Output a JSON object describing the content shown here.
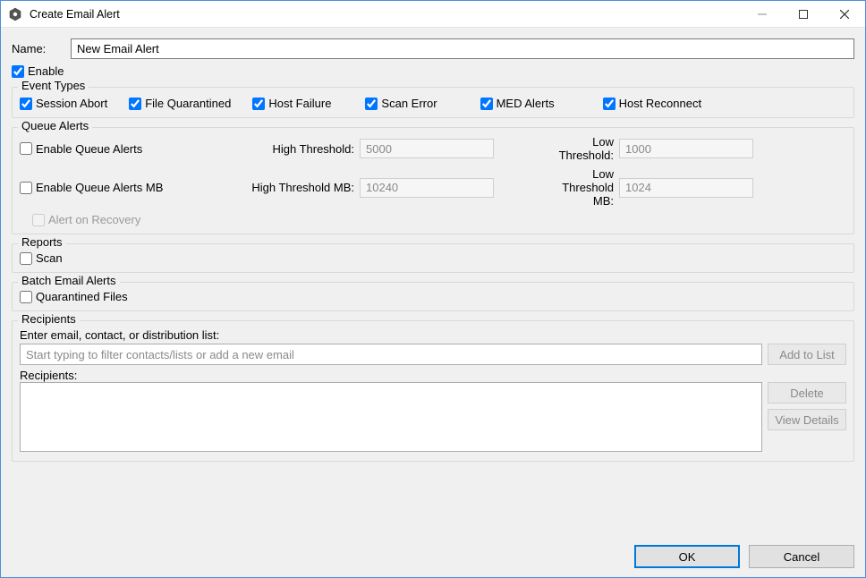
{
  "window": {
    "title": "Create Email Alert"
  },
  "name": {
    "label": "Name:",
    "value": "New Email Alert"
  },
  "enable": {
    "label": "Enable",
    "checked": true
  },
  "eventTypes": {
    "legend": "Event Types",
    "items": [
      {
        "label": "Session Abort",
        "checked": true
      },
      {
        "label": "File Quarantined",
        "checked": true
      },
      {
        "label": "Host Failure",
        "checked": true
      },
      {
        "label": "Scan Error",
        "checked": true
      },
      {
        "label": "MED Alerts",
        "checked": true
      },
      {
        "label": "Host Reconnect",
        "checked": true
      }
    ]
  },
  "queueAlerts": {
    "legend": "Queue Alerts",
    "enableQueueAlerts": {
      "label": "Enable Queue Alerts",
      "checked": false
    },
    "enableQueueAlertsMB": {
      "label": "Enable Queue Alerts MB",
      "checked": false
    },
    "alertOnRecovery": {
      "label": "Alert on Recovery",
      "checked": false,
      "disabled": true
    },
    "highThreshold": {
      "label": "High Threshold:",
      "value": "5000"
    },
    "lowThreshold": {
      "label": "Low Threshold:",
      "value": "1000"
    },
    "highThresholdMB": {
      "label": "High Threshold MB:",
      "value": "10240"
    },
    "lowThresholdMB": {
      "label": "Low Threshold MB:",
      "value": "1024"
    }
  },
  "reports": {
    "legend": "Reports",
    "scan": {
      "label": "Scan",
      "checked": false
    }
  },
  "batchEmailAlerts": {
    "legend": "Batch Email Alerts",
    "quarantinedFiles": {
      "label": "Quarantined Files",
      "checked": false
    }
  },
  "recipients": {
    "legend": "Recipients",
    "enterLabel": "Enter email, contact, or distribution list:",
    "placeholder": "Start typing to filter contacts/lists or add a new email",
    "addToList": "Add to List",
    "listLabel": "Recipients:",
    "delete": "Delete",
    "viewDetails": "View Details"
  },
  "buttons": {
    "ok": "OK",
    "cancel": "Cancel"
  }
}
